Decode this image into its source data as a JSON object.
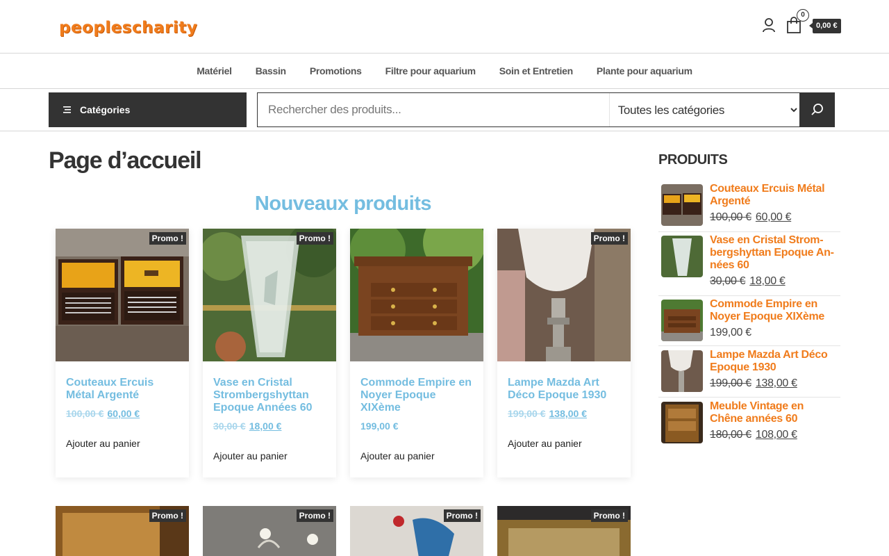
{
  "header": {
    "logo": "peoplescharity",
    "cart_count": "0",
    "cart_total": "0,00 €"
  },
  "nav": [
    "Matériel",
    "Bassin",
    "Promotions",
    "Filtre pour aquarium",
    "Soin et Entretien",
    "Plante pour aquarium"
  ],
  "search": {
    "categories_label": "Catégories",
    "placeholder": "Rechercher des produits...",
    "select_value": "Toutes les catégories"
  },
  "main": {
    "page_title": "Page d’accueil",
    "section_title": "Nouveaux produits",
    "products": [
      {
        "name": "Couteaux Ercuis Métal Argenté",
        "old_price": "100,00 €",
        "price": "60,00 €",
        "badge": "Promo !",
        "add": "Ajouter au panier"
      },
      {
        "name": "Vase en Cristal Strombergshyttan Epoque Années 60",
        "old_price": "30,00 €",
        "price": "18,00 €",
        "badge": "Promo !",
        "add": "Ajouter au panier"
      },
      {
        "name": "Commode Empire en Noyer Epoque XIXème",
        "old_price": "",
        "price": "199,00 €",
        "badge": "",
        "add": "Ajouter au panier"
      },
      {
        "name": "Lampe Mazda Art Déco Epoque 1930",
        "old_price": "199,00 €",
        "price": "138,00 €",
        "badge": "Promo !",
        "add": "Ajouter au panier"
      }
    ],
    "row2_badges": [
      "Promo !",
      "Promo !",
      "Promo !",
      "Promo !"
    ]
  },
  "sidebar": {
    "title": "PRODUITS",
    "items": [
      {
        "name": "Couteaux Ercuis Métal Argenté",
        "old_price": "100,00 €",
        "price": "60,00 €"
      },
      {
        "name": "Vase en Cristal Strom­bergshyttan Epoque An­nées 60",
        "old_price": "30,00 €",
        "price": "18,00 €"
      },
      {
        "name": "Commode Empire en Noyer Epoque XIXème",
        "old_price": "",
        "price": "199,00 €"
      },
      {
        "name": "Lampe Mazda Art Déco Epoque 1930",
        "old_price": "199,00 €",
        "price": "138,00 €"
      },
      {
        "name": "Meuble Vintage en Chêne années 60",
        "old_price": "180,00 €",
        "price": "108,00 €"
      }
    ]
  },
  "colors": {
    "accent": "#f07c1c",
    "link": "#74bde0",
    "dark": "#333333"
  },
  "icons": [
    "user-icon",
    "cart-icon",
    "menu-icon",
    "search-icon"
  ]
}
